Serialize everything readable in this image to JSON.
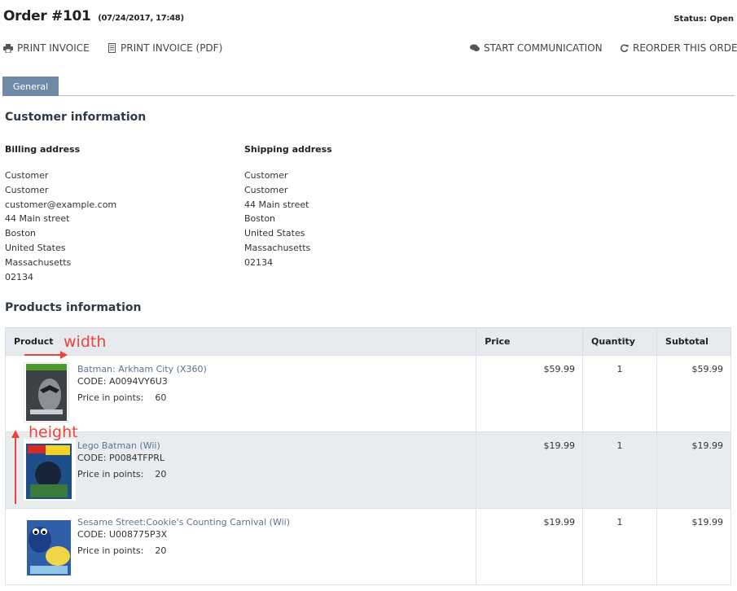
{
  "order": {
    "title": "Order #101",
    "date": "(07/24/2017, 17:48)",
    "status_label": "Status:",
    "status_value": "Open"
  },
  "actions": {
    "print_invoice": "PRINT INVOICE",
    "print_invoice_pdf": "PRINT INVOICE (PDF)",
    "start_communication": "START COMMUNICATION",
    "reorder": "REORDER THIS ORDER"
  },
  "tabs": [
    {
      "label": "General",
      "active": true
    }
  ],
  "customer": {
    "section_title": "Customer information",
    "billing": {
      "heading": "Billing address",
      "lines": [
        "Customer",
        "Customer",
        "customer@example.com",
        "44 Main street",
        "Boston",
        "United States",
        "Massachusetts",
        "02134"
      ]
    },
    "shipping": {
      "heading": "Shipping address",
      "lines": [
        "Customer",
        "Customer",
        "44 Main street",
        "Boston",
        "United States",
        "Massachusetts",
        "02134"
      ]
    }
  },
  "products": {
    "section_title": "Products information",
    "columns": [
      "Product",
      "Price",
      "Quantity",
      "Subtotal"
    ],
    "points_label": "Price in points:",
    "rows": [
      {
        "name": "Batman: Arkham City (X360)",
        "code": "CODE: A0094VY6U3",
        "points": "60",
        "price": "$59.99",
        "quantity": "1",
        "subtotal": "$59.99"
      },
      {
        "name": "Lego Batman (Wii)",
        "code": "CODE: P0084TFPRL",
        "points": "20",
        "price": "$19.99",
        "quantity": "1",
        "subtotal": "$19.99"
      },
      {
        "name": "Sesame Street:Cookie's Counting Carnival (Wii)",
        "code": "CODE: U008775P3X",
        "points": "20",
        "price": "$19.99",
        "quantity": "1",
        "subtotal": "$19.99"
      }
    ]
  },
  "annotations": {
    "width": "width",
    "height": "height",
    "color": "#e8463b"
  },
  "colors": {
    "tab_active": "#6f8aa6",
    "link": "#5a7390",
    "header_bg": "#e6e9ed"
  }
}
